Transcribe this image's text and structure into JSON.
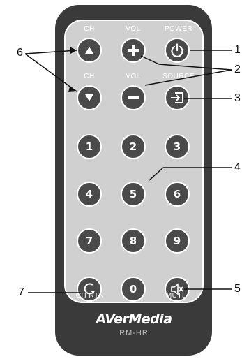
{
  "remote": {
    "brand": "AVerMedia",
    "model": "RM-HR",
    "labels": {
      "ch_top": "CH",
      "vol_top": "VOL",
      "power": "POWER",
      "ch_bottom": "CH",
      "vol_bottom": "VOL",
      "source": "SOURCE",
      "ch_rtn": "CH RTN",
      "mute": "MUTE"
    },
    "digits": [
      "1",
      "2",
      "3",
      "4",
      "5",
      "6",
      "7",
      "8",
      "9",
      "0"
    ],
    "icons": {
      "ch_up": "triangle-up-icon",
      "vol_up": "plus-icon",
      "power": "power-icon",
      "ch_down": "triangle-down-icon",
      "vol_down": "minus-icon",
      "source": "input-source-icon",
      "ch_rtn": "return-arrow-icon",
      "mute": "mute-speaker-icon"
    },
    "colors": {
      "body": "#3a3a3a",
      "panel": "#d0d0d0",
      "button": "#4a4a4a"
    }
  },
  "callouts": [
    "1",
    "2",
    "3",
    "4",
    "5",
    "6",
    "7"
  ]
}
